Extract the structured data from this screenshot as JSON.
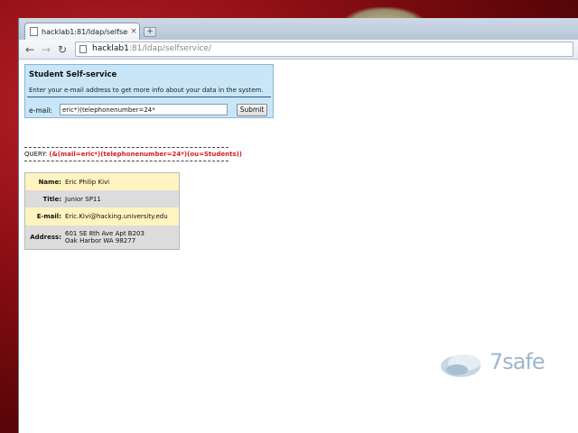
{
  "browser": {
    "tab": {
      "title": "hacklab1:81/ldap/selfserv...",
      "close": "×"
    },
    "new_tab": "+",
    "nav": {
      "back": "←",
      "forward": "→",
      "reload": "↻"
    },
    "address": {
      "host": "hacklab1",
      "rest": ":81/ldap/selfservice/"
    }
  },
  "form": {
    "title": "Student Self-service",
    "description": "Enter your e-mail address to get more info about your data in the system.",
    "email_label": "e-mail:",
    "email_value": "eric*)(telephonenumber=24*",
    "submit_label": "Submit"
  },
  "query": {
    "label": "QUERY:",
    "value": "(&(mail=eric*)(telephonenumber=24*)(ou=Students))"
  },
  "record": [
    {
      "label": "Name:",
      "value": "Eric Philip Kivi"
    },
    {
      "label": "Title:",
      "value": "Junior SP11"
    },
    {
      "label": "E-mail:",
      "value": "Eric.Kivi@hacking.university.edu"
    },
    {
      "label": "Address:",
      "value": "601 SE 8th Ave Apt B203",
      "value2": "Oak Harbor WA 98277"
    }
  ],
  "logo": {
    "text": "7safe"
  },
  "colors": {
    "panel_bg": "#c9e6f8",
    "query_red": "#d21e1e",
    "row_yellow": "#fff3bf",
    "row_gray": "#dcdcdc"
  }
}
